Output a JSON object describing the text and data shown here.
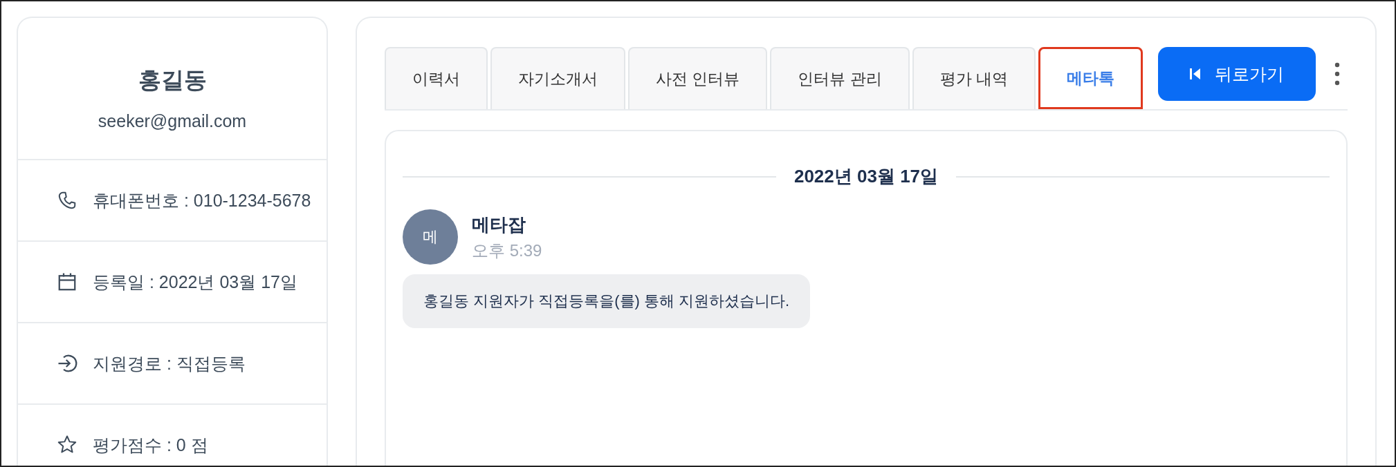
{
  "profile": {
    "name": "홍길동",
    "email": "seeker@gmail.com",
    "details": [
      {
        "kind": "phone",
        "text": "휴대폰번호 : 010-1234-5678"
      },
      {
        "kind": "calendar",
        "text": "등록일 : 2022년 03월 17일"
      },
      {
        "kind": "route",
        "text": "지원경로 : 직접등록"
      },
      {
        "kind": "star",
        "text": "평가점수 : 0 점"
      }
    ]
  },
  "tabs": [
    {
      "label": "이력서",
      "selected": false
    },
    {
      "label": "자기소개서",
      "selected": false
    },
    {
      "label": "사전 인터뷰",
      "selected": false
    },
    {
      "label": "인터뷰 관리",
      "selected": false
    },
    {
      "label": "평가 내역",
      "selected": false
    },
    {
      "label": "메타톡",
      "selected": true
    }
  ],
  "back_button": {
    "label": "뒤로가기"
  },
  "chat": {
    "date": "2022년 03월 17일",
    "messages": [
      {
        "avatar": "메",
        "sender": "메타잡",
        "time": "오후 5:39",
        "text": "홍길동 지원자가 직접등록을(를) 통해 지원하셨습니다."
      }
    ]
  }
}
